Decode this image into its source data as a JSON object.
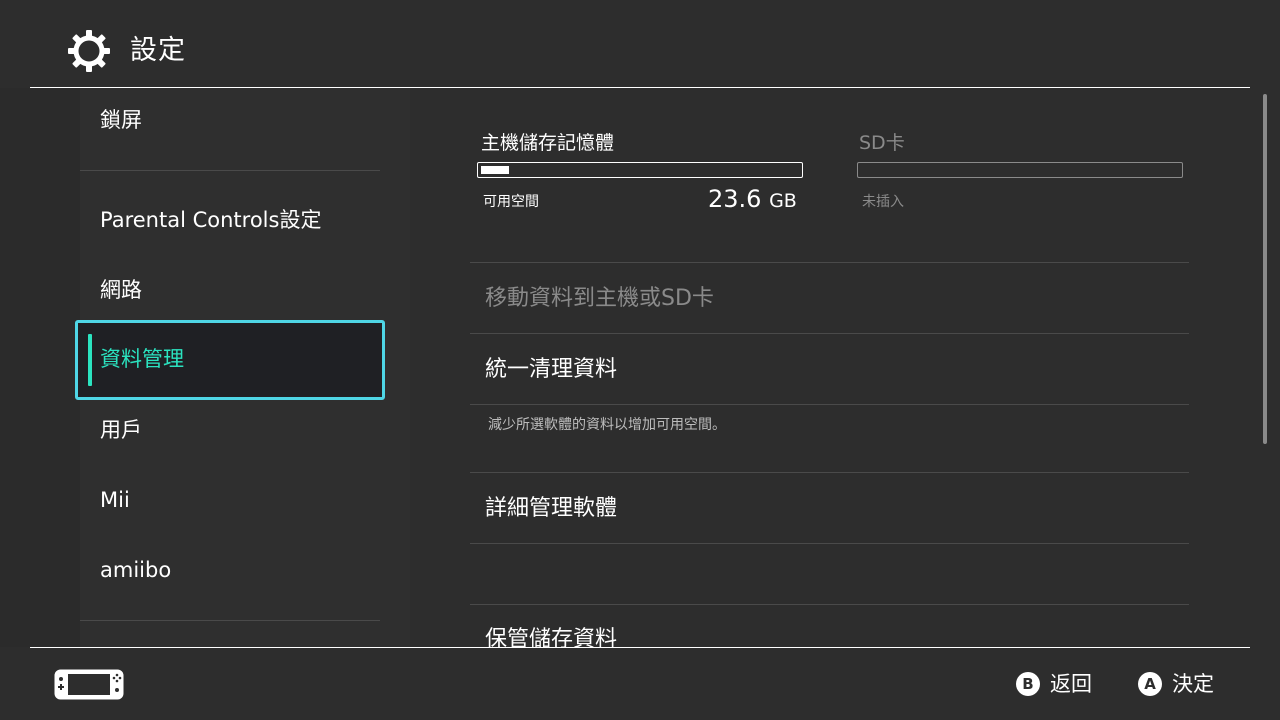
{
  "header": {
    "title": "設定",
    "icon": "gear-icon"
  },
  "sidebar": {
    "items": [
      {
        "label": "鎖屏"
      },
      {
        "label": "Parental Controls設定"
      },
      {
        "label": "網路"
      },
      {
        "label": "資料管理",
        "selected": true
      },
      {
        "label": "用戶"
      },
      {
        "label": "Mii"
      },
      {
        "label": "amiibo"
      }
    ]
  },
  "storage": {
    "console": {
      "label": "主機儲存記憶體",
      "free_label": "可用空間",
      "free_value": "23.6",
      "free_unit": "GB",
      "used_fraction": 0.09
    },
    "sd": {
      "label": "SD卡",
      "status": "未插入"
    }
  },
  "menu": {
    "move": "移動資料到主機或SD卡",
    "cleanup": "統一清理資料",
    "cleanup_desc": "減少所選軟體的資料以增加可用空間。",
    "manage": "詳細管理軟體",
    "save": "保管儲存資料"
  },
  "footer": {
    "back_key": "B",
    "back_label": "返回",
    "ok_key": "A",
    "ok_label": "決定"
  },
  "colors": {
    "accent": "#2be3c0",
    "focus": "#4fd6e6",
    "background": "#2d2d2d"
  }
}
